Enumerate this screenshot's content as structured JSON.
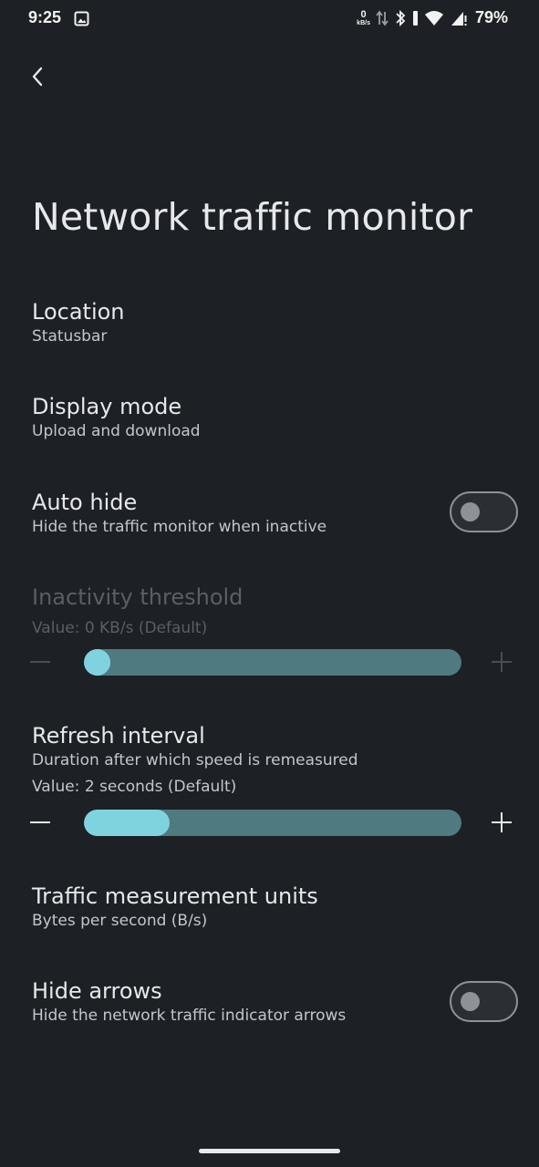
{
  "status_bar": {
    "time": "9:25",
    "net_speed": "0",
    "net_speed_unit": "kB/s",
    "battery": "79%"
  },
  "header": {
    "back_icon": "chevron-left-icon",
    "title": "Network traffic monitor"
  },
  "settings": {
    "location": {
      "title": "Location",
      "value": "Statusbar"
    },
    "display_mode": {
      "title": "Display mode",
      "value": "Upload and download"
    },
    "auto_hide": {
      "title": "Auto hide",
      "summary": "Hide the traffic monitor when inactive",
      "enabled": false
    },
    "inactivity_threshold": {
      "title": "Inactivity threshold",
      "value_text": "Value: 0 KB/s (Default)",
      "level": 0.0,
      "disabled": true
    },
    "refresh_interval": {
      "title": "Refresh interval",
      "summary": "Duration after which speed is remeasured",
      "value_text": "Value: 2 seconds (Default)",
      "level": 0.17
    },
    "units": {
      "title": "Traffic measurement units",
      "value": "Bytes per second (B/s)"
    },
    "hide_arrows": {
      "title": "Hide arrows",
      "summary": "Hide the network traffic indicator arrows",
      "enabled": false
    }
  },
  "colors": {
    "background": "#1d2024",
    "accent": "#7fd3df",
    "track": "#4f7a80"
  }
}
